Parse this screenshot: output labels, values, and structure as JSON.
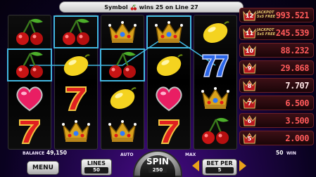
{
  "message": {
    "prefix": "Symbol",
    "text": "wins 25 on Line 27",
    "symbol_icon": "cherry-icon"
  },
  "reels": [
    [
      "cherry-icon",
      "cherry-icon",
      "heart-icon",
      "seven-icon"
    ],
    [
      "cherry-icon",
      "lemon-icon",
      "seven-icon",
      "crown-icon"
    ],
    [
      "crown-icon",
      "cherry-icon",
      "lemon-icon",
      "crown-icon"
    ],
    [
      "crown-icon",
      "lemon-icon",
      "heart-icon",
      "seven-icon"
    ],
    [
      "lemon-icon",
      "blue-seven-icon",
      "crown-icon",
      "cherry-icon"
    ]
  ],
  "jackpot_label": "JACKPOT",
  "jackpot_label_line2": "5x5 FREE",
  "jackpots": [
    {
      "count": "12",
      "value": "993.521"
    },
    {
      "count": "11",
      "value": "245.539"
    },
    {
      "count": "10",
      "value": "88.232"
    },
    {
      "count": "9",
      "value": "29.868"
    },
    {
      "count": "8",
      "value": "7.707"
    },
    {
      "count": "7",
      "value": "6.500"
    },
    {
      "count": "6",
      "value": "3.500"
    },
    {
      "count": "5",
      "value": "2.000"
    }
  ],
  "bottom": {
    "balance_label": "BALANCE",
    "balance_value": "49,150",
    "auto_label": "AUTO",
    "max_label": "MAX",
    "win_value": "50",
    "win_label": "WIN",
    "menu_label": "MENU",
    "lines_label": "LINES",
    "lines_value": "50",
    "spin_label": "SPIN",
    "spin_value": "250",
    "betper_label": "BET PER",
    "betper_value": "5"
  },
  "colors": {
    "win_frame": "#42b7e0",
    "jackpot_value": "#ff5a5a"
  }
}
